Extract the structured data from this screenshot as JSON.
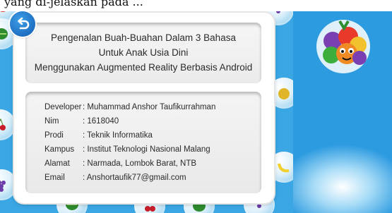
{
  "caption_fragment": "yang di-jelaskan pada ...",
  "header": {
    "title_line_1": "Pengenalan Buah-Buahan Dalam 3 Bahasa",
    "title_line_2": "Untuk Anak Usia Dini",
    "title_line_3": "Menggunakan Augmented Reality Berbasis Android"
  },
  "developer_info": [
    {
      "label": "Developer",
      "value": ": Muhammad Anshor Taufikurrahman"
    },
    {
      "label": "Nim",
      "value": ": 1618040"
    },
    {
      "label": "Prodi",
      "value": ": Teknik Informatika"
    },
    {
      "label": "Kampus",
      "value": ": Institut Teknologi Nasional Malang"
    },
    {
      "label": "Alamat",
      "value": ": Narmada, Lombok Barat, NTB"
    },
    {
      "label": "Email",
      "value": ": Anshortaufik77@gmail.com"
    }
  ],
  "icons": {
    "back": "back-arrow-icon",
    "mascot": "fruit-mascot-icon"
  },
  "colors": {
    "background_blue": "#3aa6e3",
    "button_blue": "#1f6fc2",
    "card_white": "#ffffff",
    "text_dark": "#2b2b2b"
  }
}
